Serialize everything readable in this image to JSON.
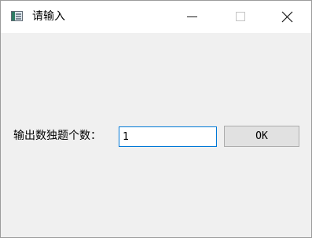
{
  "window": {
    "title": "请输入",
    "controls": {
      "minimize_icon": "minimize-icon",
      "maximize_icon": "maximize-icon",
      "close_icon": "close-icon"
    }
  },
  "dialog": {
    "prompt_label": "输出数独题个数：",
    "count_input": {
      "value": "1",
      "placeholder": ""
    },
    "ok_label": "OK"
  },
  "colors": {
    "dialog_background": "#f0f0f0",
    "titlebar_background": "#ffffff",
    "input_focus_border": "#0078d7",
    "button_background": "#e1e1e1",
    "button_border": "#adadad",
    "maximize_disabled": "#c4c4c4"
  }
}
